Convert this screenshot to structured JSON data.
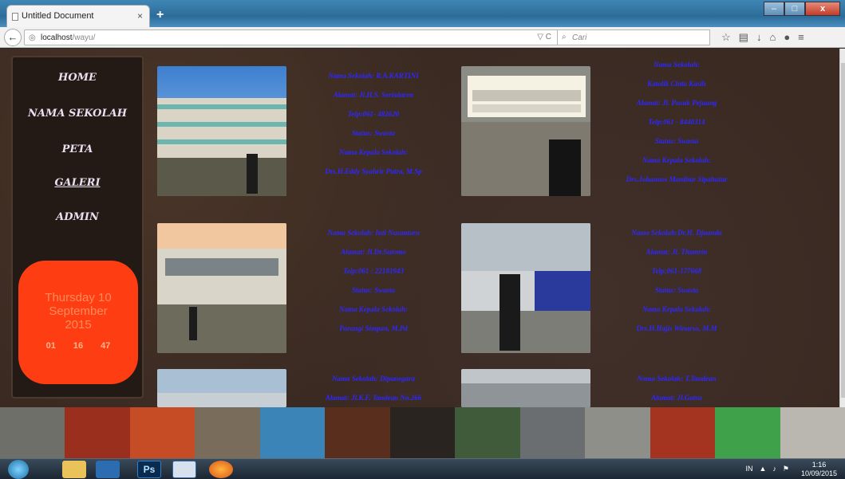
{
  "browser": {
    "tab_title": "Untitled Document",
    "tab_close": "×",
    "new_tab": "+",
    "url_host": "localhost",
    "url_path": "/wayu/",
    "search_placeholder": "Cari",
    "reload_icon": "reload-icon",
    "win_min": "–",
    "win_max": "□",
    "win_close": "x"
  },
  "sidebar": {
    "items": [
      {
        "label": "HOME"
      },
      {
        "label": "NAMA SEKOLAH"
      },
      {
        "label": "PETA"
      },
      {
        "label": "GALERI"
      },
      {
        "label": "ADMIN"
      }
    ],
    "clock": {
      "line1": "Thursday 10",
      "line2": "September",
      "line3": "2015",
      "h": "01",
      "m": "16",
      "s": "47"
    }
  },
  "schools": [
    {
      "lines": [
        "Nama Sekolah: R.A.KARTINI",
        "Alamat: Jl.H.S. Serisdaren",
        "Telp:061- 482620",
        "Status: Swasta",
        "Nama Kepala Sekolah:",
        "Drs.H.Eddy Syahrir Putra, M.Sp"
      ]
    },
    {
      "lines": [
        "Nama Sekolah:",
        "Katolik Cinta Kasih",
        "Alamat: Jl. Pusuk Pejuang",
        "Telp:061 - 8440314",
        "Status: Swasta",
        "Nama Kepala Sekolah:",
        "Drs.Johannes Manihur Sipahutar"
      ]
    },
    {
      "lines": [
        "Nama Sekolah: Inti Nusantara",
        "Alamat: Jl.Dr.Sutomo",
        "Telp:061 : 22181943",
        "Status: Swasta",
        "Nama Kepala Sekolah:",
        "Parangi Simpan, M.Pd"
      ]
    },
    {
      "lines": [
        "Nama Sekolah:Dr.H. Djuanda",
        "Alamat: Jl. Thamrin",
        "Telp:061-177668",
        "Status: Swasta",
        "Nama Kepala Sekolah:",
        "Drs.H.Hajis Winarso, M.M"
      ]
    },
    {
      "lines": [
        "Nama Sekolah: Dipanegara",
        "Alamat: Jl.K.F. Tandean No.266"
      ]
    },
    {
      "lines": [
        "Nama Sekolah: T.Tandean",
        "Alamat: Jl.Gatsu"
      ]
    }
  ],
  "taskbar": {
    "ps_label": "Ps",
    "lang": "IN",
    "time": "1:16",
    "date": "10/09/2015"
  }
}
